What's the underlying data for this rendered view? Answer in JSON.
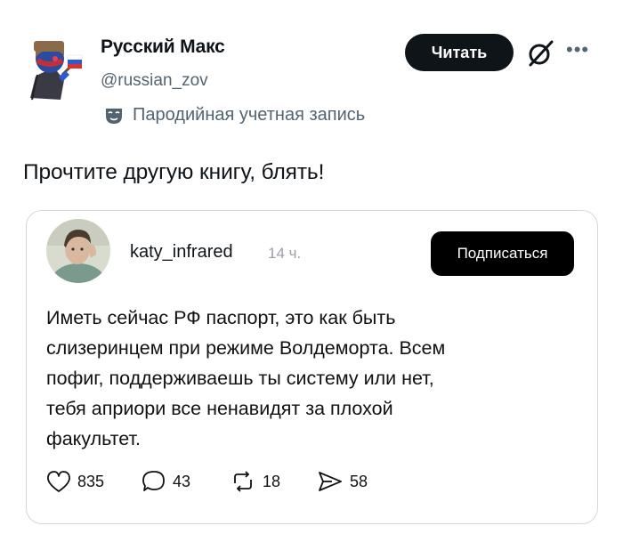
{
  "header": {
    "author_name": "Русский Макс",
    "author_handle": "@russian_zov",
    "follow_label": "Читать",
    "parody_label": "Пародийная учетная запись"
  },
  "tweet": {
    "text": "Прочтите другую книгу, блять!"
  },
  "quote": {
    "username": "katy_infrared",
    "time": "14 ч.",
    "subscribe_label": "Подписаться",
    "body_lines": [
      "Иметь сейчас РФ паспорт, это как быть",
      "слизеринцем при режиме Волдеморта.  Всем",
      "пофиг, поддерживаешь ты систему или нет,",
      "тебя априори все ненавидят за плохой",
      "факультет."
    ],
    "stats": {
      "likes": "835",
      "replies": "43",
      "reposts": "18",
      "shares": "58"
    }
  },
  "icons": {
    "grok": "grok-icon",
    "more": "more-icon",
    "mask": "mask-icon",
    "heart": "heart-icon",
    "reply": "reply-icon",
    "repost": "repost-icon",
    "share": "share-icon"
  },
  "colors": {
    "primary_text": "#0f1419",
    "secondary_text": "#536471",
    "button_bg": "#0f1419",
    "border": "#cfd9de"
  }
}
